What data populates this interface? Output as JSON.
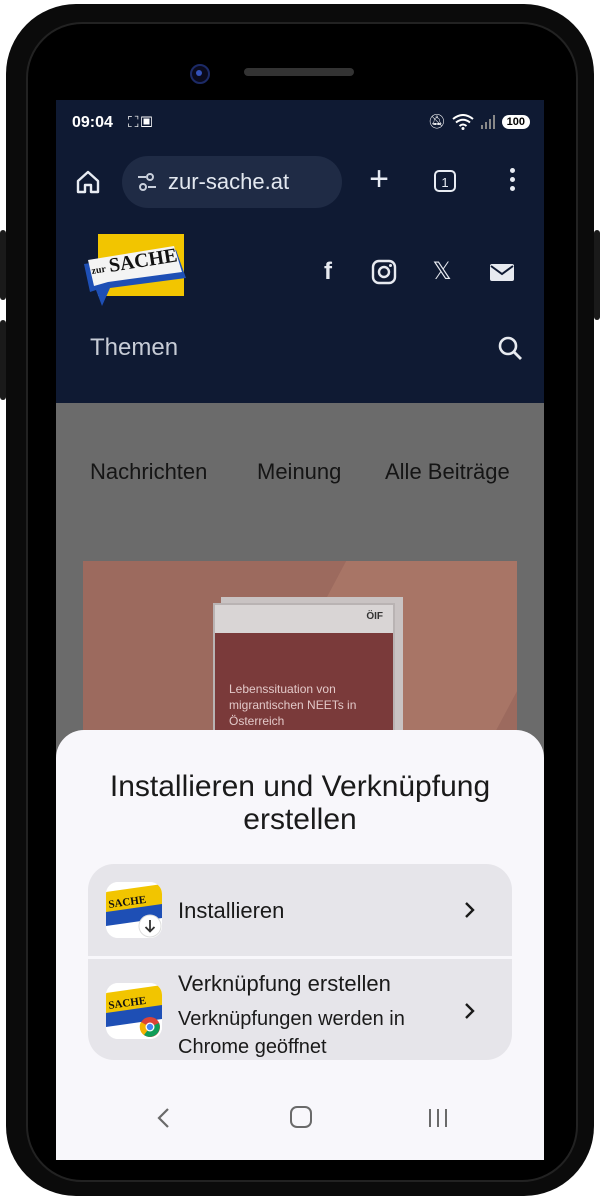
{
  "status_bar": {
    "time": "09:04",
    "battery": "100",
    "left_icons": [
      "screenshot-icon",
      "cast-icon"
    ],
    "right_icons": [
      "mute-icon",
      "wifi-icon",
      "signal-icon"
    ]
  },
  "browser": {
    "url": "zur-sache.at",
    "tab_count": "1",
    "new_tab_label": "+"
  },
  "site": {
    "logo_text_small": "zur",
    "logo_text_big": "SACHE",
    "social_icons": [
      "facebook-icon",
      "instagram-icon",
      "x-icon",
      "mail-icon"
    ],
    "social_glyphs": {
      "facebook": "f",
      "x": "𝕏"
    },
    "themen_label": "Themen",
    "nav": [
      "Nachrichten",
      "Meinung",
      "Alle Beiträge"
    ],
    "hero": {
      "doc_logo": "ÖIF",
      "doc_title": "Lebenssituation von migrantischen NEETs in Österreich"
    }
  },
  "sheet": {
    "title": "Installieren und Verknüpfung erstellen",
    "options": [
      {
        "label": "Installieren",
        "sublabel": ""
      },
      {
        "label": "Verknüpfung erstellen",
        "sublabel": "Verknüpfungen werden in Chrome geöffnet"
      }
    ]
  },
  "colors": {
    "browser_bg": "#0f1a33",
    "sheet_bg": "#f8f7fb",
    "option_bg": "#e6e5ea",
    "logo_yellow": "#f2c500",
    "logo_blue": "#1e4fb5"
  }
}
